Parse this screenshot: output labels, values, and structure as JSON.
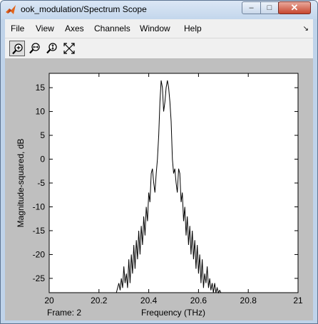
{
  "window": {
    "title": "ook_modulation/Spectrum Scope"
  },
  "menu": [
    "File",
    "View",
    "Axes",
    "Channels",
    "Window",
    "Help"
  ],
  "toolbar": {
    "tools": [
      "zoom-in-icon",
      "zoom-x-icon",
      "zoom-y-icon",
      "autoscale-icon"
    ]
  },
  "frame_label": "Frame: 2",
  "chart_data": {
    "type": "line",
    "xlabel": "Frequency (THz)",
    "ylabel": "Magnitude-squared, dB",
    "xlim": [
      20,
      21
    ],
    "ylim": [
      -28,
      18
    ],
    "xticks": [
      "20",
      "20.2",
      "20.4",
      "20.6",
      "20.8",
      "21"
    ],
    "yticks": [
      "15",
      "10",
      "5",
      "0",
      "-5",
      "-10",
      "-15",
      "-20",
      "-25"
    ],
    "grid": false,
    "series": [
      {
        "color": "#000000",
        "x": [
          20.27,
          20.28,
          20.285,
          20.29,
          20.295,
          20.3,
          20.305,
          20.31,
          20.315,
          20.32,
          20.325,
          20.33,
          20.335,
          20.34,
          20.345,
          20.35,
          20.355,
          20.36,
          20.365,
          20.37,
          20.375,
          20.38,
          20.385,
          20.39,
          20.395,
          20.4,
          20.405,
          20.41,
          20.415,
          20.42,
          20.425,
          20.43,
          20.435,
          20.44,
          20.445,
          20.45,
          20.455,
          20.46,
          20.465,
          20.47,
          20.475,
          20.48,
          20.485,
          20.49,
          20.495,
          20.5,
          20.505,
          20.51,
          20.515,
          20.52,
          20.525,
          20.53,
          20.535,
          20.54,
          20.545,
          20.55,
          20.555,
          20.56,
          20.565,
          20.57,
          20.575,
          20.58,
          20.585,
          20.59,
          20.595,
          20.6,
          20.605,
          20.61,
          20.615,
          20.62,
          20.625,
          20.63,
          20.635,
          20.64,
          20.645,
          20.65,
          20.655,
          20.66,
          20.665,
          20.67,
          20.675,
          20.68,
          20.685,
          20.69,
          20.7
        ],
        "y": [
          -28,
          -26,
          -27.5,
          -25,
          -27,
          -22.5,
          -26,
          -24,
          -27,
          -21,
          -26,
          -20,
          -24,
          -18,
          -23,
          -17,
          -21,
          -15,
          -20,
          -14,
          -18,
          -12,
          -16,
          -10,
          -13,
          -7,
          -9,
          -3,
          -2,
          -5,
          -7,
          -3,
          0,
          5,
          12,
          16.5,
          15,
          10,
          12,
          15,
          16.5,
          15,
          12,
          8,
          0,
          -3,
          -2,
          -5,
          -7,
          -2,
          -3,
          -9,
          -7,
          -13,
          -10,
          -16,
          -12,
          -18,
          -14,
          -20,
          -15,
          -21,
          -17,
          -23,
          -18,
          -24,
          -20,
          -26,
          -21,
          -27,
          -24,
          -26,
          -22.5,
          -27,
          -25,
          -27.5,
          -26,
          -28,
          -26,
          -28,
          -27,
          -28,
          -27.5,
          -28,
          -28
        ]
      }
    ]
  }
}
